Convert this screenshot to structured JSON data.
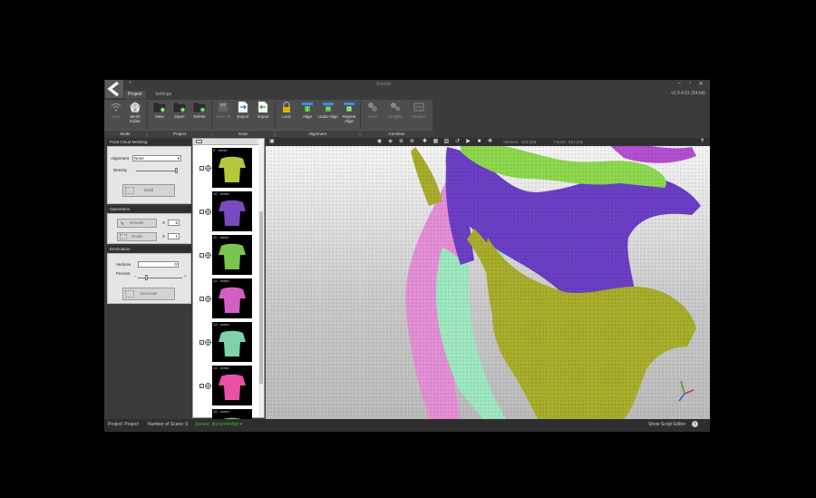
{
  "window": {
    "title": "Scenify",
    "version": "v1.0.4.51 (64-bit)",
    "tabs": [
      {
        "label": "Project",
        "active": true
      },
      {
        "label": "Settings",
        "active": false
      }
    ],
    "quick_access": "+"
  },
  "ribbon": {
    "groups": [
      {
        "label": "Mode"
      },
      {
        "label": "Project"
      },
      {
        "label": "Scan"
      },
      {
        "label": "Alignment"
      },
      {
        "label": "Combine"
      }
    ],
    "buttons": [
      {
        "label": "Scan",
        "icon": "wifi-icon",
        "enabled": false
      },
      {
        "label": "Mesh Editor",
        "icon": "mesh-editor-icon",
        "enabled": true
      },
      {
        "label": "New",
        "icon": "folder-new-icon",
        "enabled": true
      },
      {
        "label": "Open",
        "icon": "folder-open-icon",
        "enabled": true
      },
      {
        "label": "Delete",
        "icon": "folder-delete-icon",
        "enabled": true
      },
      {
        "label": "Save All",
        "icon": "save-icon",
        "enabled": false
      },
      {
        "label": "Export",
        "icon": "export-icon",
        "enabled": true
      },
      {
        "label": "Import",
        "icon": "import-icon",
        "enabled": true
      },
      {
        "label": "Lock",
        "icon": "lock-icon",
        "enabled": true
      },
      {
        "label": "Align",
        "icon": "align-icon",
        "enabled": true
      },
      {
        "label": "Undo Align",
        "icon": "undo-align-icon",
        "enabled": true
      },
      {
        "label": "Repeat Align",
        "icon": "repeat-align-icon",
        "enabled": true
      },
      {
        "label": "Fuse",
        "icon": "fuse-icon",
        "enabled": false
      },
      {
        "label": "Simplify",
        "icon": "simplify-icon",
        "enabled": false
      },
      {
        "label": "Finalize",
        "icon": "finalize-icon",
        "enabled": false
      }
    ]
  },
  "left_panel": {
    "point_cloud_meshing": {
      "title": "Point Cloud Meshing",
      "alignment_label": "Alignment",
      "alignment_value": "None",
      "density_label": "Density",
      "density_value": 1.0,
      "build_label": "Build"
    },
    "operations": {
      "title": "Operations",
      "smooth_label": "Smooth",
      "smooth_times": "5",
      "erode_label": "Erode",
      "erode_times": "1",
      "times_symbol": "X"
    },
    "decimation": {
      "title": "Decimation",
      "vertices_label": "Vertices",
      "vertices_value": "0",
      "percent_label": "Percent",
      "percent_value": 0.2,
      "minus": "−",
      "plus": "+",
      "decimate_label": "Decimate"
    }
  },
  "scan_list": {
    "items": [
      {
        "name": "9 - mesh",
        "color": "#b6c83a",
        "checked": true
      },
      {
        "name": "10 - mesh",
        "color": "#7a49c2",
        "checked": true
      },
      {
        "name": "11 - mesh",
        "color": "#78c44e",
        "checked": true
      },
      {
        "name": "12 - mesh",
        "color": "#d35fc2",
        "checked": true
      },
      {
        "name": "13 - mesh",
        "color": "#7ed3a7",
        "checked": true
      },
      {
        "name": "14 - mesh",
        "color": "#e94fa6",
        "checked": true
      },
      {
        "name": "15 - mesh",
        "color": "#8fd060",
        "checked": true
      }
    ]
  },
  "viewport_toolbar": {
    "vertices_label": "Vertices:",
    "vertices_value": "423,196",
    "faces_label": "Faces:",
    "faces_value": "831,242",
    "help": "?"
  },
  "status_bar": {
    "project": "Project: Project",
    "scans": "Number of Scans: 9",
    "sensor": "Sensor: disconnected",
    "script_editor": "Show Script Editor"
  },
  "colors": {
    "olive_mesh": "#a8ad2c",
    "purple_mesh": "#6a3fc4",
    "green_mesh": "#86d64c",
    "pink_mesh": "#e08ad2",
    "mint_mesh": "#8fe3c6"
  }
}
